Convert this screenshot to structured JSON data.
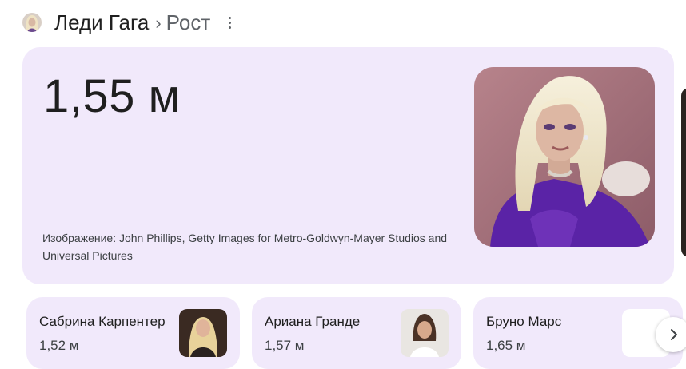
{
  "header": {
    "entity": "Леди Гага",
    "separator": "›",
    "attribute": "Рост"
  },
  "answer": {
    "value": "1,55 м",
    "image_credit": "Изображение: John Phillips, Getty Images for Metro-Goldwyn-Mayer Studios and Universal Pictures"
  },
  "related": [
    {
      "name": "Сабрина Карпентер",
      "height": "1,52 м"
    },
    {
      "name": "Ариана Гранде",
      "height": "1,57 м"
    },
    {
      "name": "Бруно Марс",
      "height": "1,65 м"
    }
  ],
  "icons": {
    "more": "more-vert-icon",
    "next": "chevron-right-icon"
  },
  "colors": {
    "card_bg": "#f1e9fb",
    "title": "#1f1f1f",
    "secondary": "#5f6368",
    "dress_purple": "#5a23a6"
  }
}
